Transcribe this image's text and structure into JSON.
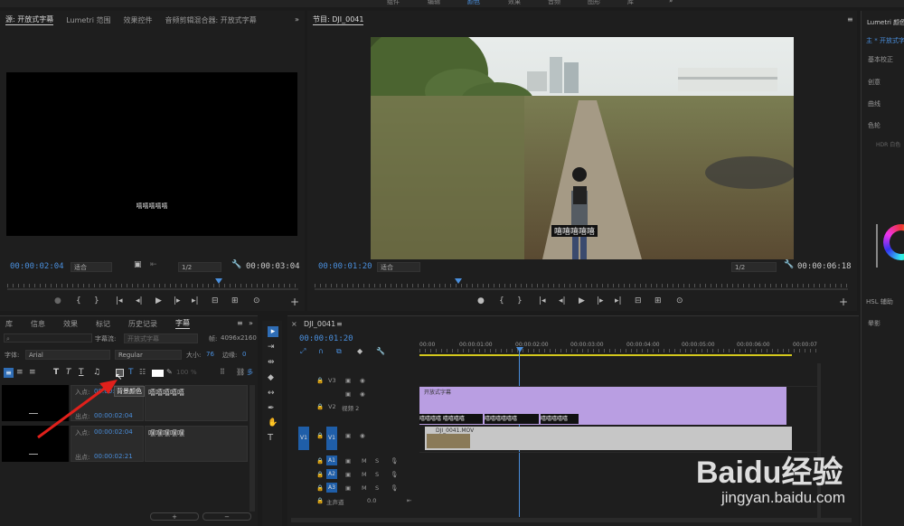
{
  "top_tabs": {
    "tab1": "组件",
    "tab2": "编辑",
    "tab3": "颜色",
    "tab4": "效果",
    "tab5": "音频",
    "tab6": "图形",
    "tab7": "库"
  },
  "source_panel": {
    "tab1": "源: 开放式字幕",
    "tab2": "Lumetri 范围",
    "tab3": "效果控件",
    "tab4": "音频剪辑混合器: 开放式字幕",
    "caption": "嘻嘻嘻嘻嘻",
    "timecode_in": "00:00:02:04",
    "fit": "适合",
    "res": "1/2",
    "timecode_dur": "00:00:03:04"
  },
  "program_panel": {
    "title": "节目: DJI_0041",
    "subtitle": "嘻嘻嘻嘻嘻",
    "timecode": "00:00:01:20",
    "fit": "适合",
    "res": "1/2",
    "duration": "00:00:06:18"
  },
  "right_panel": {
    "title": "Lumetri 颜色",
    "sub": "主 * 开放式字幕",
    "items": {
      "i1": "基本校正",
      "i2": "创意",
      "i3": "曲线",
      "i4": "色轮",
      "i5": "HDR 白色",
      "i6": "HSL 辅助",
      "i7": "晕影"
    }
  },
  "lower_tabs": {
    "t1": "库",
    "t2": "信息",
    "t3": "效果",
    "t4": "标记",
    "t5": "历史记录",
    "t6": "字幕"
  },
  "captions_panel": {
    "stream_label": "字幕流:",
    "stream_value": "开放式字幕",
    "frame_label": "帧:",
    "frame_value": "4096x2160",
    "font_label": "字体:",
    "font": "Arial",
    "style": "Regular",
    "size_label": "大小:",
    "size": "76",
    "edge_label": "边缘:",
    "edge": "0",
    "tooltip": "背景颜色",
    "bg_pct1": "100",
    "bg_pct2": "%",
    "multi": "多",
    "entries": [
      {
        "in_label": "入点:",
        "in": "00:00:00:00",
        "out_label": "出点:",
        "out": "00:00:02:04",
        "text": "嘻嘻嘻嘻嘻"
      },
      {
        "in_label": "入点:",
        "in": "00:00:02:04",
        "out_label": "出点:",
        "out": "00:00:02:21",
        "text": "嘿嘿嘿嘿嘿"
      }
    ]
  },
  "timeline": {
    "tab": "DJI_0041",
    "timecode": "00:00:01:20",
    "ruler": [
      "00:00",
      "00:00:01:00",
      "00:00:02:00",
      "00:00:03:00",
      "00:00:04:00",
      "00:00:05:00",
      "00:00:06:00",
      "00:00:07"
    ],
    "caption_clip": "开放式字幕",
    "video2": "视频 2",
    "video_clip": "DJI_0041.MOV",
    "master": "主声道",
    "master_val": "0.0",
    "sub_caps": [
      "嘻嘻嘻嘻 嘻嘻嘻嘻",
      "嘻嘻嘻嘻嘻嘻",
      "嘻嘻嘻嘻嘻"
    ],
    "tracks": {
      "v3": "V3",
      "v2": "V2",
      "v1": "V1",
      "a1": "A1",
      "a2": "A2",
      "a3": "A3",
      "m": "M",
      "s": "S"
    }
  },
  "watermark": {
    "brand": "Baidu经验",
    "url": "jingyan.baidu.com"
  }
}
